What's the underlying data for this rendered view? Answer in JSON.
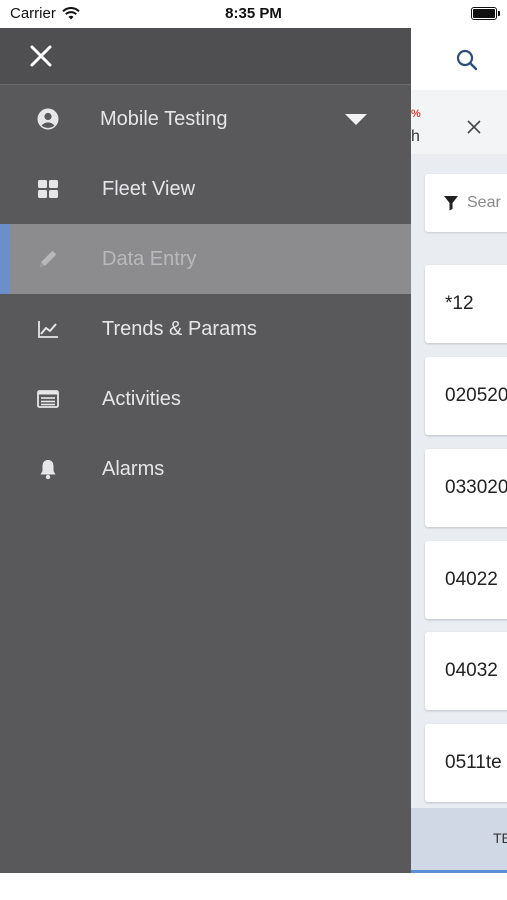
{
  "status_bar": {
    "carrier": "Carrier",
    "time": "8:35 PM"
  },
  "drawer": {
    "account": {
      "label": "Mobile Testing",
      "icon": "user-circle-icon"
    },
    "items": [
      {
        "label": "Fleet View",
        "icon": "grid-icon"
      },
      {
        "label": "Data Entry",
        "icon": "pencil-icon",
        "active": true
      },
      {
        "label": "Trends & Params",
        "icon": "trend-chart-icon"
      },
      {
        "label": "Activities",
        "icon": "list-card-icon"
      },
      {
        "label": "Alarms",
        "icon": "bell-icon"
      }
    ]
  },
  "background": {
    "pct": "%",
    "h_fragment": "h",
    "search_placeholder": "Sear",
    "cards": [
      "*12",
      "020520",
      "033020",
      "04022",
      "04032",
      "0511te"
    ],
    "tab_label": "TE"
  },
  "colors": {
    "drawer_bg": "#59595c",
    "drawer_top": "#4f4f52",
    "active_bg": "#8c8c8f",
    "active_accent": "#6a8fc9",
    "alert_red": "#e0463c",
    "tab_underline": "#5b8fd6"
  }
}
